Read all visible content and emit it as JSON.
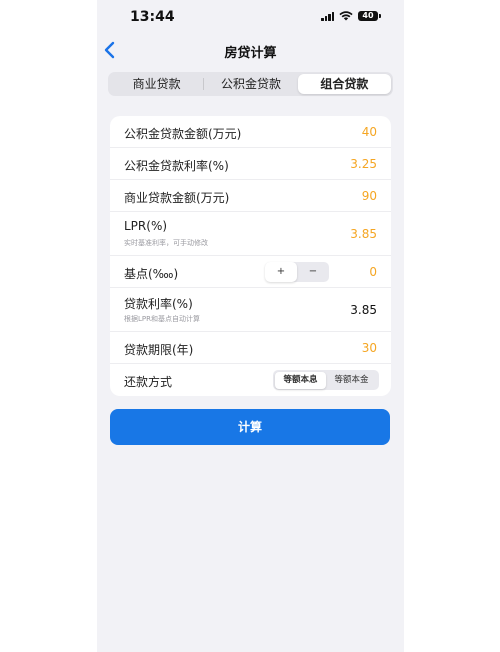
{
  "status_bar": {
    "time": "13:44",
    "battery": "40"
  },
  "nav": {
    "title": "房贷计算"
  },
  "tabs": [
    {
      "label": "商业贷款",
      "active": false
    },
    {
      "label": "公积金贷款",
      "active": false
    },
    {
      "label": "组合贷款",
      "active": true
    }
  ],
  "form": {
    "fund_amount": {
      "label": "公积金贷款金额(万元)",
      "value": "40"
    },
    "fund_rate": {
      "label": "公积金贷款利率(%)",
      "value": "3.25"
    },
    "commercial_amount": {
      "label": "商业贷款金额(万元)",
      "value": "90"
    },
    "lpr": {
      "label": "LPR(%)",
      "hint": "实时基准利率，可手动修改",
      "value": "3.85"
    },
    "basis_points": {
      "label": "基点(‱)",
      "plus": "+",
      "minus": "−",
      "value": "0"
    },
    "loan_rate": {
      "label": "贷款利率(%)",
      "hint": "根据LPR和基点自动计算",
      "value": "3.85"
    },
    "loan_term": {
      "label": "贷款期限(年)",
      "value": "30"
    },
    "repayment": {
      "label": "还款方式",
      "options": [
        "等额本息",
        "等额本金"
      ],
      "selected": "等额本息"
    }
  },
  "actions": {
    "calculate": "计算"
  },
  "colors": {
    "accent": "#1877e6",
    "value_orange": "#f5a623",
    "background": "#f2f2f6"
  }
}
